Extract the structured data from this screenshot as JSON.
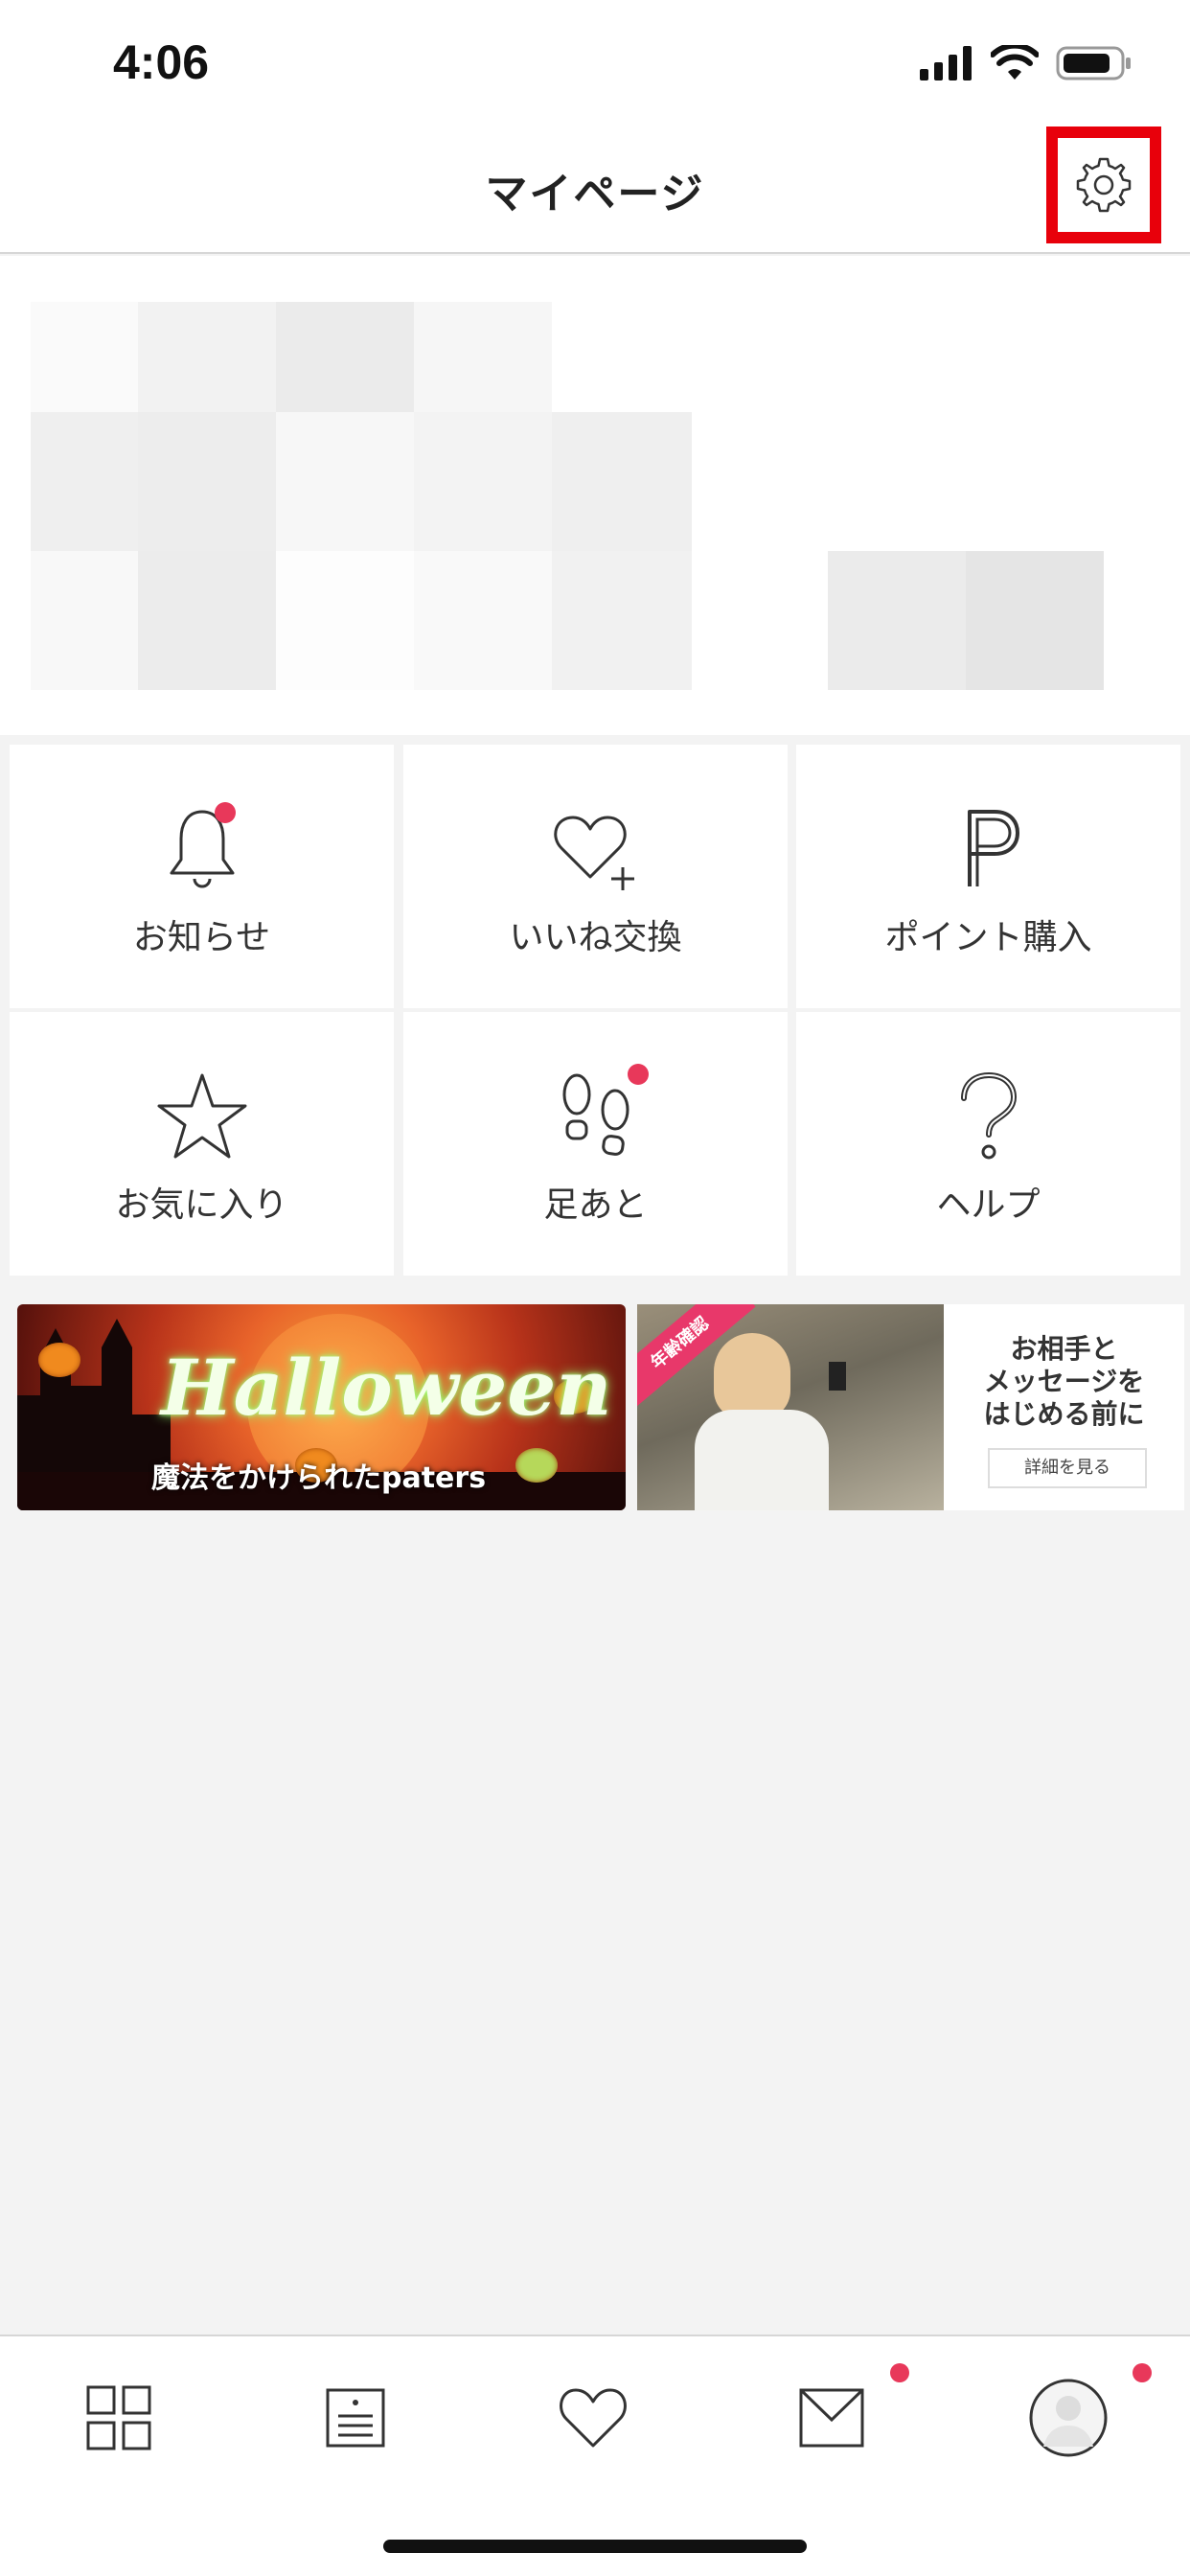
{
  "status_bar": {
    "time": "4:06"
  },
  "header": {
    "title": "マイページ",
    "settings_icon": "gear-icon",
    "highlight_color": "#e8000b"
  },
  "menu": {
    "items": [
      {
        "label": "お知らせ",
        "icon": "bell-icon",
        "badge": true
      },
      {
        "label": "いいね交換",
        "icon": "heart-plus-icon",
        "badge": false
      },
      {
        "label": "ポイント購入",
        "icon": "points-p-icon",
        "badge": false
      },
      {
        "label": "お気に入り",
        "icon": "star-icon",
        "badge": false
      },
      {
        "label": "足あと",
        "icon": "footprints-icon",
        "badge": true
      },
      {
        "label": "ヘルプ",
        "icon": "question-icon",
        "badge": false
      }
    ],
    "badge_color": "#e8385a"
  },
  "banners": {
    "halloween": {
      "headline": "Halloween",
      "subtitle": "魔法をかけられたpaters"
    },
    "verification": {
      "ribbon": "年齢確認",
      "text_line1": "お相手と",
      "text_line2": "メッセージを",
      "text_line3": "はじめる前に",
      "button_label": "詳細を見る"
    }
  },
  "tab_bar": {
    "tabs": [
      {
        "icon": "grid-icon",
        "badge": false
      },
      {
        "icon": "board-icon",
        "badge": false
      },
      {
        "icon": "heart-icon",
        "badge": false
      },
      {
        "icon": "mail-icon",
        "badge": true
      },
      {
        "icon": "avatar-icon",
        "badge": true
      }
    ]
  }
}
